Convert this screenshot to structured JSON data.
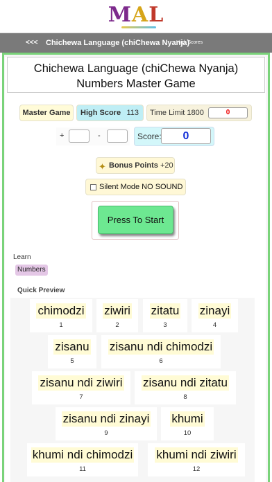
{
  "header": {
    "logo": {
      "m": "M",
      "a": "A",
      "l": "L"
    },
    "back": "<<<",
    "title": "Chichewa Language (chiChewa Nyanja)",
    "high_scores_link": "High Scores"
  },
  "game": {
    "title_line1": "Chichewa Language (chiChewa Nyanja)",
    "title_line2": "Numbers Master Game",
    "mode": "Master Game",
    "high_score_label": "High Score",
    "high_score_value": "113",
    "time_limit_label": "Time Limit 1800",
    "time_value": "0",
    "plus": "+",
    "minus": "-",
    "score_label": "Score:",
    "score_value": "0",
    "bonus_label": "Bonus Points",
    "bonus_value": "+20",
    "silent_label": "Silent Mode NO SOUND",
    "start_label": "Press To Start"
  },
  "learn": {
    "label": "Learn",
    "topic": "Numbers",
    "quick_preview": "Quick Preview"
  },
  "preview_items": [
    {
      "word": "chimodzi",
      "num": "1"
    },
    {
      "word": "ziwiri",
      "num": "2"
    },
    {
      "word": "zitatu",
      "num": "3"
    },
    {
      "word": "zinayi",
      "num": "4"
    },
    {
      "word": "zisanu",
      "num": "5"
    },
    {
      "word": "zisanu ndi chimodzi",
      "num": "6"
    },
    {
      "word": "zisanu ndi ziwiri",
      "num": "7"
    },
    {
      "word": "zisanu ndi zitatu",
      "num": "8"
    },
    {
      "word": "zisanu ndi zinayi",
      "num": "9"
    },
    {
      "word": "khumi",
      "num": "10"
    },
    {
      "word": "khumi ndi chimodzi",
      "num": "11"
    },
    {
      "word": "khumi ndi ziwiri",
      "num": "12"
    }
  ],
  "colors": {
    "accent_green": "#7ad37a",
    "start_button": "#6de891",
    "score_blue": "#1330d8",
    "time_red": "#e00000"
  }
}
